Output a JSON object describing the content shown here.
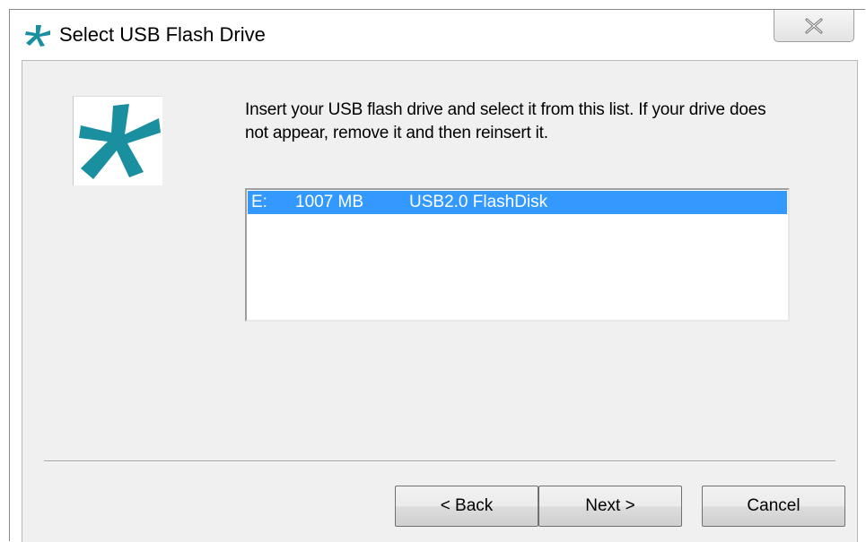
{
  "window": {
    "title": "Select USB Flash Drive",
    "close_icon": "close-x-icon",
    "app_icon": "asterisk-logo-icon"
  },
  "colors": {
    "logo": "#1a8fa0",
    "selection": "#3399ff",
    "panel": "#f0f0f0"
  },
  "main": {
    "instruction": "Insert your USB flash drive and select it from this list. If your drive does not appear, remove it and then reinsert it.",
    "drives": [
      {
        "drive": "E:",
        "size": "1007 MB",
        "name": "USB2.0 FlashDisk",
        "selected": true
      }
    ]
  },
  "buttons": {
    "back": "< Back",
    "next": "Next >",
    "cancel": "Cancel"
  }
}
